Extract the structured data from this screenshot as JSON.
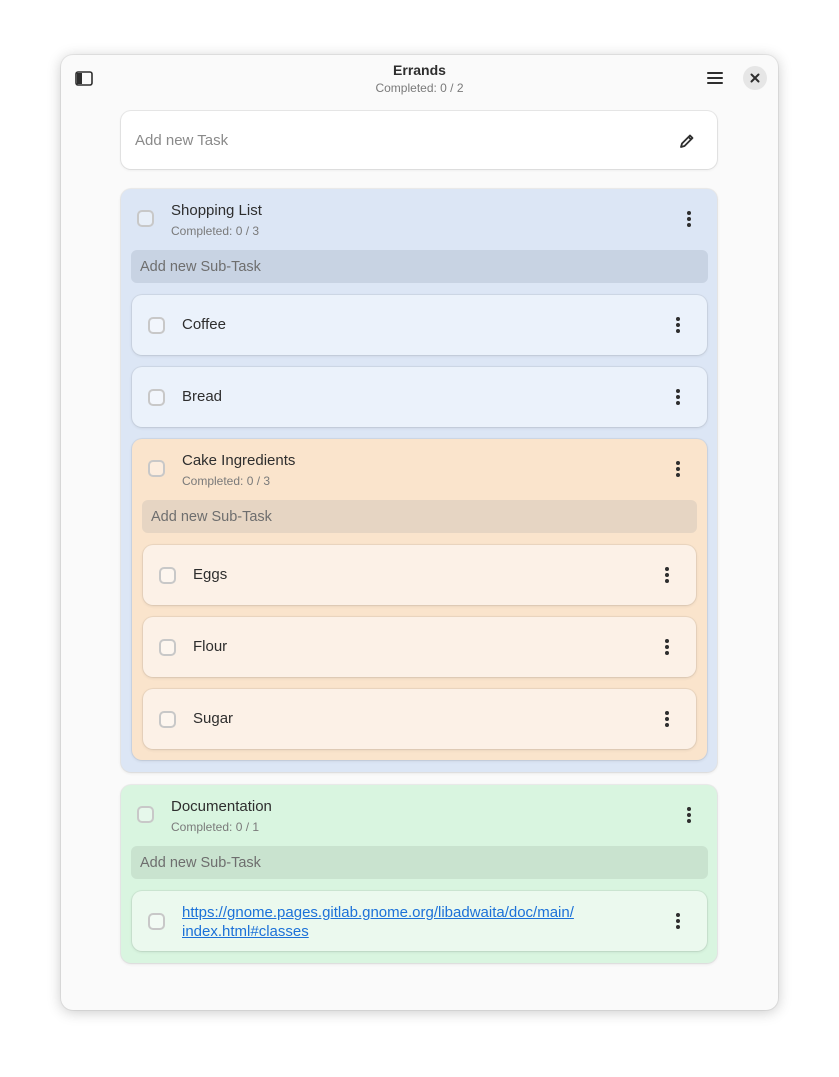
{
  "window": {
    "title": "Errands",
    "subtitle": "Completed: 0 / 2"
  },
  "new_task": {
    "placeholder": "Add new Task"
  },
  "colors": {
    "blue_card": "#dce6f5",
    "blue_item": "#ebf2fb",
    "blue_input": "#c8d3e3",
    "orange_card": "#fae4cc",
    "orange_item": "#fcf1e7",
    "orange_input": "#e6d5c3",
    "green_card": "#d9f5e0",
    "green_item": "#ebf9ee",
    "green_input": "#c9e3cf",
    "link": "#1c71d8"
  },
  "tasks": [
    {
      "title": "Shopping List",
      "completed": "Completed: 0 / 3",
      "subtask_placeholder": "Add new Sub-Task",
      "items": [
        {
          "title": "Coffee"
        },
        {
          "title": "Bread"
        },
        {
          "title": "Cake Ingredients",
          "completed": "Completed: 0 / 3",
          "subtask_placeholder": "Add new Sub-Task",
          "items": [
            {
              "title": "Eggs"
            },
            {
              "title": "Flour"
            },
            {
              "title": "Sugar"
            }
          ]
        }
      ]
    },
    {
      "title": "Documentation",
      "completed": "Completed: 0 / 1",
      "subtask_placeholder": "Add new Sub-Task",
      "items": [
        {
          "link_line1": "https://gnome.pages.gitlab.gnome.org/libadwaita/doc/main/",
          "link_line2": "index.html#classes"
        }
      ]
    }
  ]
}
